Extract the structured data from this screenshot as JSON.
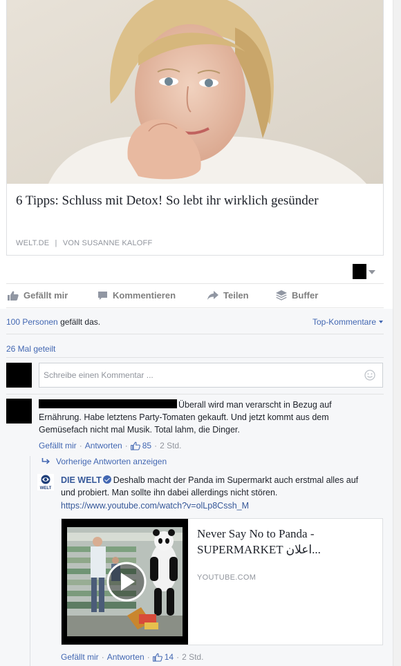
{
  "article": {
    "image_alt": "Portrait of a smiling blonde woman resting her chin on her hand",
    "title": "6 Tipps: Schluss mit Detox! So lebt ihr wirklich gesünder",
    "source": "WELT.DE",
    "separator": "|",
    "byline": "VON SUSANNE KALOFF"
  },
  "actions": {
    "like": "Gefällt mir",
    "comment": "Kommentieren",
    "share": "Teilen",
    "buffer": "Buffer"
  },
  "stats": {
    "likes_link": "100 Personen",
    "likes_suffix": " gefällt das.",
    "top_comments": "Top-Kommentare",
    "shares": "26 Mal geteilt"
  },
  "comment_box": {
    "placeholder": "Schreibe einen Kommentar ..."
  },
  "comment": {
    "text": "Überall wird man verarscht in Bezug auf Ernährung. Habe letztens Party-Tomaten gekauft. Und jetzt kommt aus dem Gemüsefach nicht mal Musik. Total lahm, die Dinger.",
    "like": "Gefällt mir",
    "reply": "Antworten",
    "like_count": "85",
    "time": "2 Std.",
    "separator": "·"
  },
  "previous_replies": "Vorherige Antworten anzeigen",
  "reply": {
    "author": "DIE WELT",
    "logo_text": "WELT",
    "text": "Deshalb macht der Panda im Supermarkt auch erstmal alles auf und probiert. Man sollte ihn dabei allerdings nicht stören.",
    "link": "https://www.youtube.com/watch?v=olLp8Cssh_M",
    "like": "Gefällt mir",
    "reply": "Antworten",
    "like_count": "14",
    "time": "2 Std."
  },
  "video": {
    "title": "Never Say No to Panda - SUPERMARKET اعلان...",
    "domain": "YOUTUBE.COM"
  },
  "colors": {
    "link_blue": "#4267b2",
    "author_blue": "#365899",
    "muted_gray": "#90949c",
    "ufi_background": "#f6f7f9"
  }
}
